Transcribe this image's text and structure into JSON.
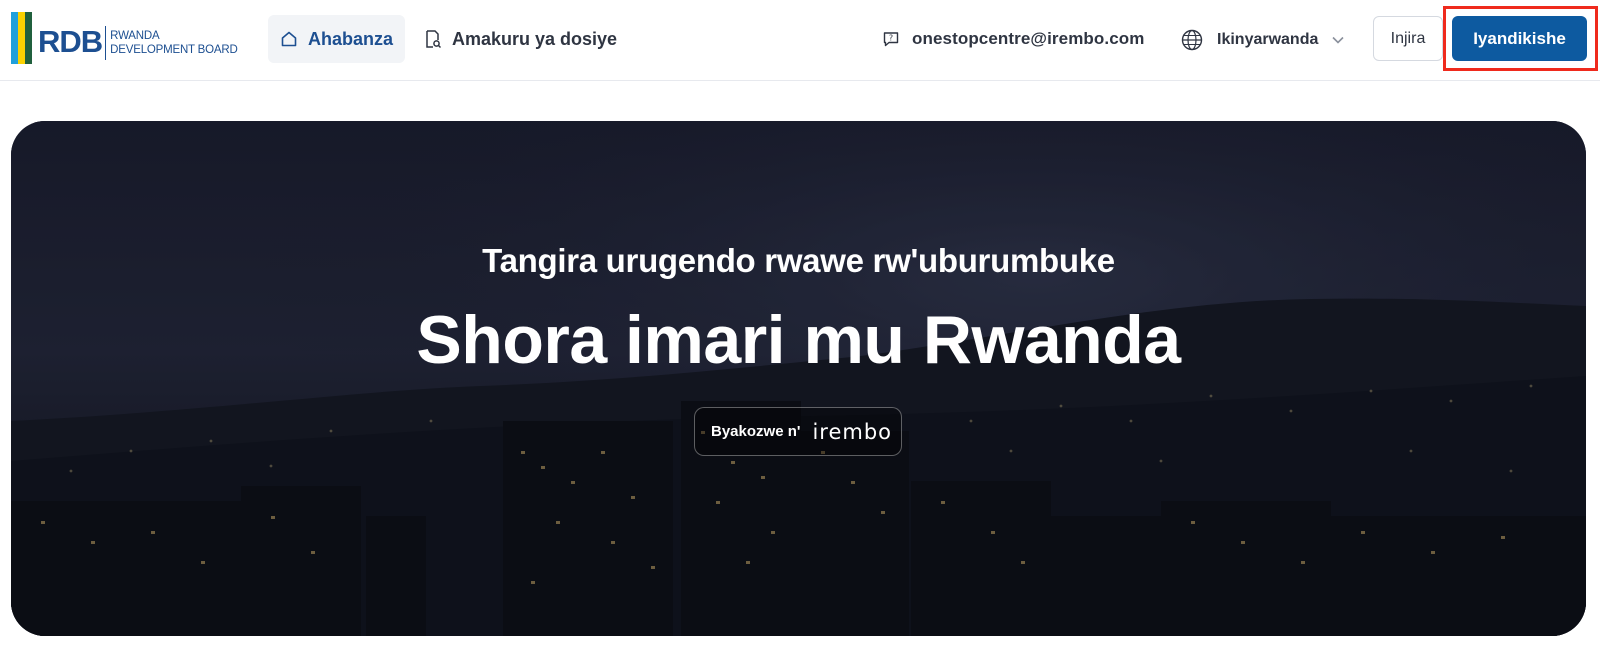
{
  "logo": {
    "abbr": "RDB",
    "line1": "RWANDA",
    "line2": "DEVELOPMENT BOARD",
    "flag_colors": [
      "#20a0db",
      "#fad201",
      "#20603d"
    ]
  },
  "nav": {
    "home_label": "Ahabanza",
    "home_icon": "home-icon",
    "docs_label": "Amakuru ya dosiye",
    "docs_icon": "file-search-icon"
  },
  "contact": {
    "email": "onestopcentre@irembo.com",
    "icon": "chat-help-icon"
  },
  "language": {
    "selected": "Ikinyarwanda",
    "icon": "globe-icon"
  },
  "auth": {
    "login_label": "Injira",
    "register_label": "Iyandikishe"
  },
  "hero": {
    "eyebrow": "Tangira urugendo rwawe rw'uburumbuke",
    "headline": "Shora imari mu Rwanda",
    "badge_prefix": "Byakozwe n'",
    "badge_brand": "irembo"
  },
  "colors": {
    "brand_blue": "#1d4f91",
    "button_blue": "#0d5aa0",
    "highlight_red": "#ef2a1d"
  }
}
